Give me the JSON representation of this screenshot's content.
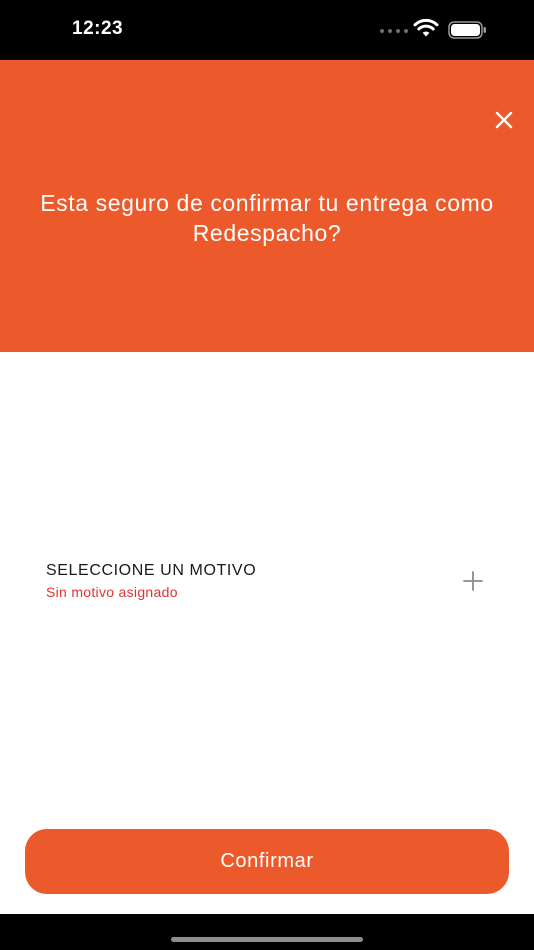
{
  "status_bar": {
    "time": "12:23"
  },
  "header": {
    "title": "Esta seguro de confirmar tu entrega como Redespacho?",
    "close_icon": "close-icon"
  },
  "reason": {
    "title": "SELECCIONE UN MOTIVO",
    "subtitle": "Sin motivo asignado",
    "add_icon": "plus-icon"
  },
  "actions": {
    "confirm_label": "Confirmar"
  },
  "colors": {
    "accent": "#ec5a2c",
    "error": "#e0332f",
    "status_bar": "#000000",
    "background": "#ffffff"
  }
}
